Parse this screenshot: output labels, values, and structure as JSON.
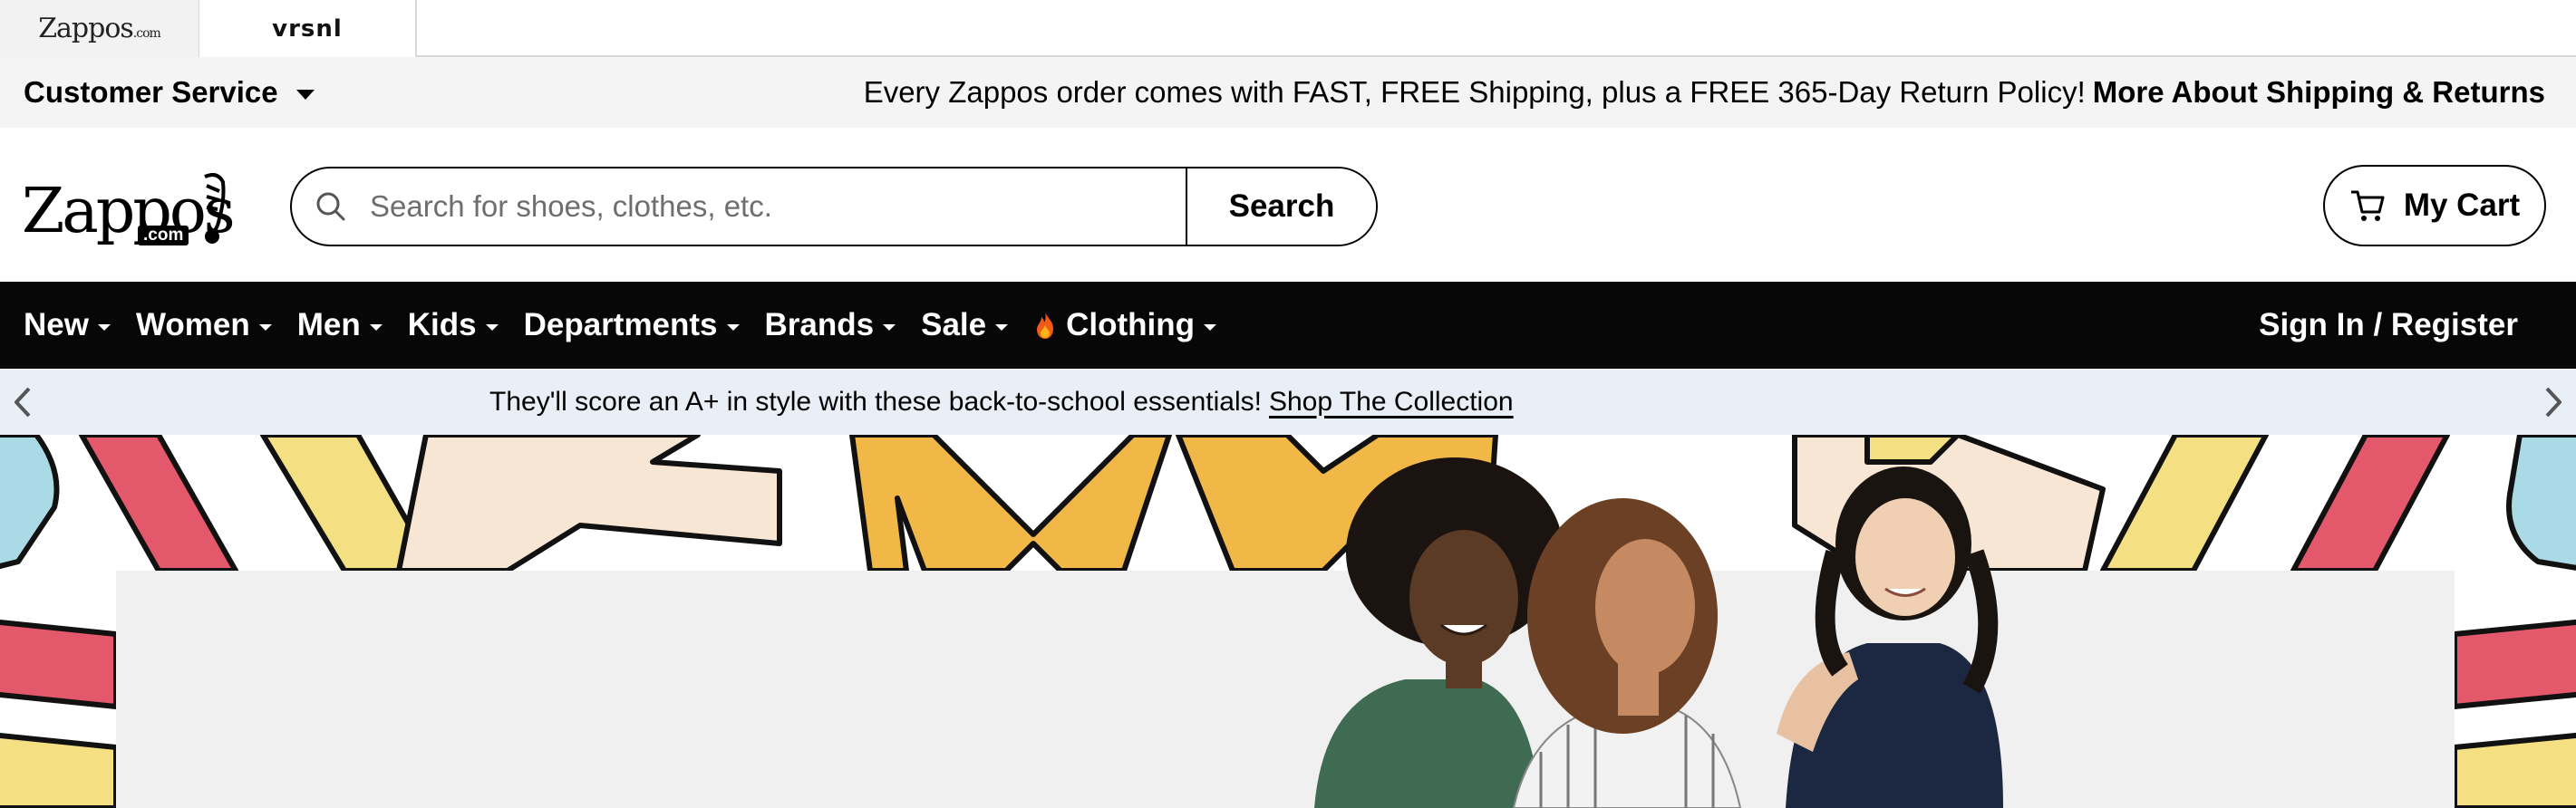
{
  "site_tabs": [
    {
      "label": "Zappos",
      "sub": ".com"
    },
    {
      "label": "vrsnl"
    }
  ],
  "utility": {
    "customer_service": "Customer Service",
    "shipping_message": "Every Zappos order comes with FAST, FREE Shipping, plus a FREE 365-Day Return Policy!",
    "shipping_link": "More About Shipping & Returns"
  },
  "header": {
    "logo_text": "Zappos",
    "logo_dotcom": ".com",
    "search_placeholder": "Search for shoes, clothes, etc.",
    "search_value": "",
    "search_button": "Search",
    "cart_label": "My Cart"
  },
  "nav": {
    "items": [
      {
        "label": "New"
      },
      {
        "label": "Women"
      },
      {
        "label": "Men"
      },
      {
        "label": "Kids"
      },
      {
        "label": "Departments"
      },
      {
        "label": "Brands"
      },
      {
        "label": "Sale"
      },
      {
        "label": "Clothing",
        "icon": "fire-icon"
      }
    ],
    "sign_in": "Sign In / Register"
  },
  "promo": {
    "text": "They'll score an A+ in style with these back-to-school essentials!",
    "link": "Shop The Collection"
  },
  "colors": {
    "nav_bg": "#070707",
    "promo_bg": "#e8eff7",
    "utility_bg": "#f4f4f4",
    "hero_red": "#e3596b",
    "hero_yellow": "#f4df82",
    "hero_orange": "#f1b847",
    "hero_peach": "#f6e6d3",
    "hero_blue": "#a9dae6"
  }
}
